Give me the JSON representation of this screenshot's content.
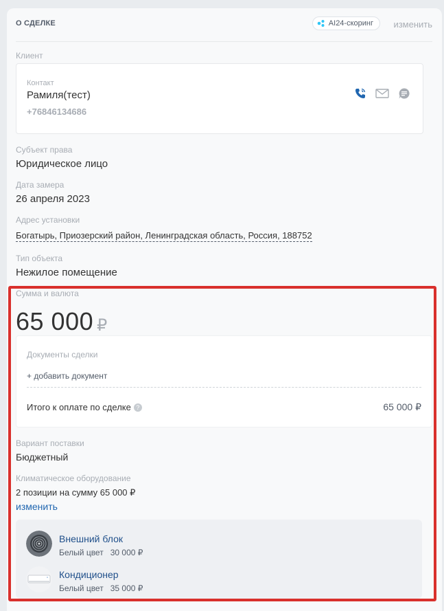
{
  "header": {
    "title": "О СДЕЛКЕ",
    "ai_badge": "AI24-скоринг",
    "edit": "изменить"
  },
  "client": {
    "label": "Клиент",
    "contact_label": "Контакт",
    "name": "Рамиля(тест)",
    "phone": "+76846134686",
    "icons": [
      "phone-icon",
      "mail-icon",
      "chat-icon"
    ]
  },
  "fields": {
    "subject_label": "Субъект права",
    "subject_value": "Юридическое лицо",
    "date_label": "Дата замера",
    "date_value": "26 апреля 2023",
    "address_label": "Адрес установки",
    "address_value": "Богатырь, Приозерский район, Ленинградская область, Россия, 188752",
    "object_label": "Тип объекта",
    "object_value": "Нежилое помещение"
  },
  "amount": {
    "label": "Сумма и валюта",
    "value": "65 000",
    "currency": "₽"
  },
  "documents": {
    "label": "Документы сделки",
    "add": "+ добавить документ",
    "total_label": "Итого к оплате по сделке",
    "total_value": "65 000 ₽"
  },
  "delivery": {
    "label": "Вариант поставки",
    "value": "Бюджетный"
  },
  "equipment": {
    "label": "Климатическое оборудование",
    "summary": "2 позиции на сумму 65 000 ₽",
    "edit": "изменить",
    "items": [
      {
        "name": "Внешний блок",
        "color": "Белый цвет",
        "price": "30 000 ₽"
      },
      {
        "name": "Кондиционер",
        "color": "Белый цвет",
        "price": "35 000 ₽"
      }
    ]
  },
  "colors": {
    "highlight": "#d9302c",
    "link": "#2066b0",
    "accent": "#2fc6f6"
  }
}
